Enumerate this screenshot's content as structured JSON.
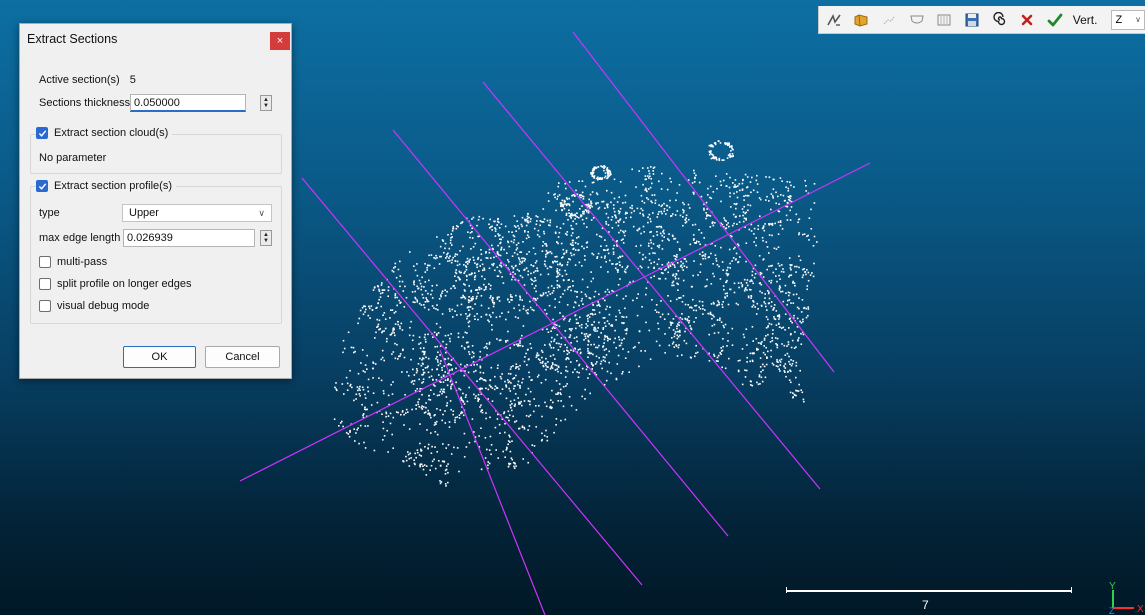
{
  "viewport": {
    "background_top": "#0d6fa3",
    "background_bottom": "#011826",
    "cloud_color": "#ffffff",
    "section_line_color": "#cc33ff"
  },
  "toolbar": {
    "buttons": [
      {
        "name": "polyline-icon"
      },
      {
        "name": "import-folder-icon"
      },
      {
        "name": "profile-icon"
      },
      {
        "name": "unfold-icon"
      },
      {
        "name": "book-icon"
      },
      {
        "name": "save-icon"
      },
      {
        "name": "spiral-icon"
      },
      {
        "name": "cancel-icon"
      },
      {
        "name": "apply-icon"
      }
    ],
    "vert_label": "Vert.",
    "axis_value": "Z",
    "accent_cancel": "#c0211e",
    "accent_apply": "#1f8a2b"
  },
  "dialog": {
    "title": "Extract Sections",
    "close_label": "×",
    "active_sections_label": "Active section(s)",
    "active_sections_value": "5",
    "thickness_label": "Sections thickness",
    "thickness_value": "0.050000",
    "cloud_group_label": "Extract section cloud(s)",
    "cloud_group_checked": true,
    "cloud_group_text": "No parameter",
    "profile_group_label": "Extract section profile(s)",
    "profile_group_checked": true,
    "type_label": "type",
    "type_value": "Upper",
    "max_edge_label": "max edge length",
    "max_edge_value": "0.026939",
    "multipass_label": "multi-pass",
    "split_label": "split profile on longer edges",
    "debug_label": "visual debug mode",
    "ok_label": "OK",
    "cancel_label": "Cancel"
  },
  "scale": {
    "label": "7"
  },
  "triad": {
    "x_label": "X",
    "y_label": "Y",
    "z_label": "Z"
  }
}
